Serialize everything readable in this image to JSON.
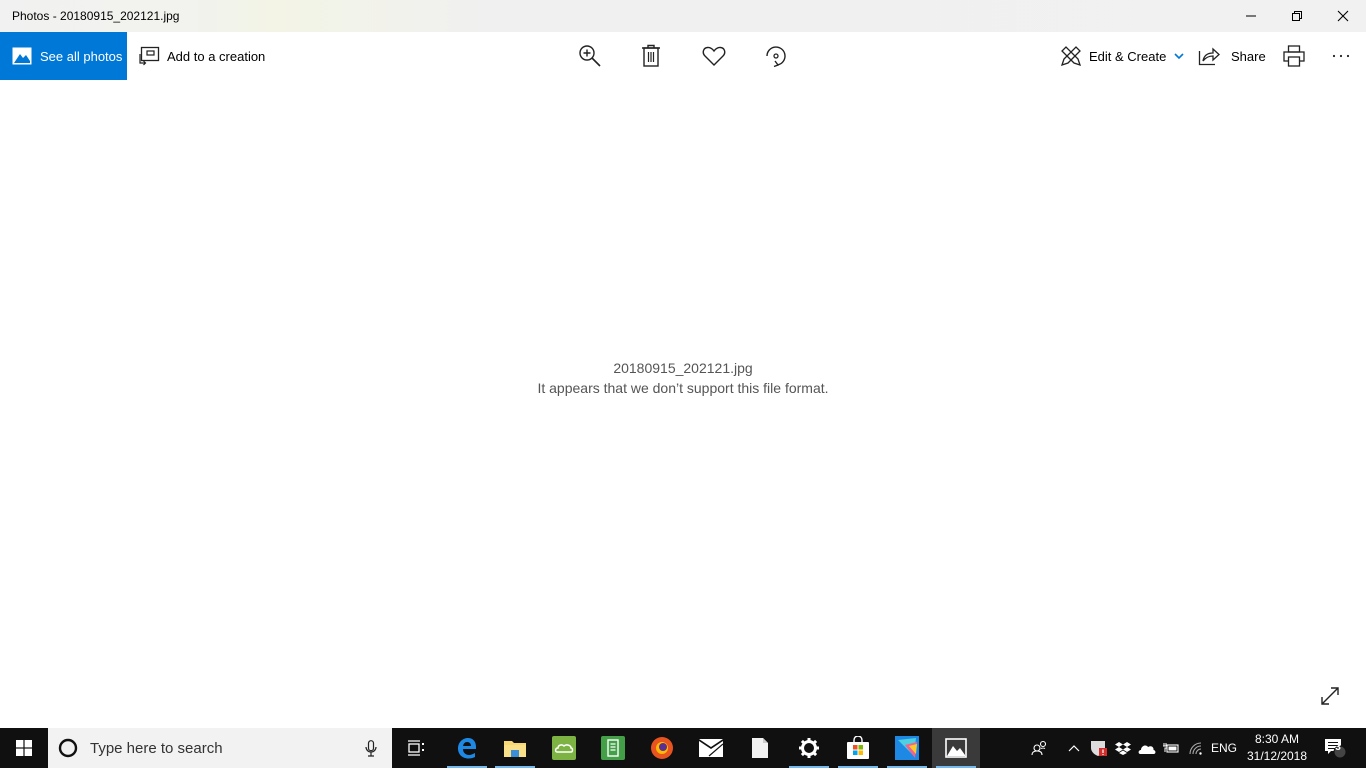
{
  "window": {
    "title": "Photos - 20180915_202121.jpg",
    "controls": {
      "minimize": "minimize-icon",
      "restore": "restore-icon",
      "close": "close-icon"
    }
  },
  "toolbar": {
    "see_all_photos": "See all photos",
    "add_to_creation": "Add to a creation",
    "zoom_icon": "zoom-in-icon",
    "delete_icon": "delete-icon",
    "favorite_icon": "heart-icon",
    "rotate_icon": "rotate-icon",
    "edit_create": "Edit & Create",
    "share": "Share",
    "print_icon": "print-icon",
    "more_icon": "more-icon",
    "accent_color": "#0078d7"
  },
  "main": {
    "filename": "20180915_202121.jpg",
    "error_message": "It appears that we don’t support this file format.",
    "fullscreen_icon": "expand-icon"
  },
  "taskbar": {
    "search_placeholder": "Type here to search",
    "apps": [
      {
        "name": "Microsoft Edge",
        "running": true
      },
      {
        "name": "File Explorer",
        "running": true
      },
      {
        "name": "Cloud app",
        "running": false
      },
      {
        "name": "Notes app",
        "running": false
      },
      {
        "name": "Firefox",
        "running": false
      },
      {
        "name": "Mail",
        "running": false
      },
      {
        "name": "Document",
        "running": false
      },
      {
        "name": "Settings",
        "running": true
      },
      {
        "name": "Microsoft Store",
        "running": true
      },
      {
        "name": "Paint app",
        "running": true
      },
      {
        "name": "Photos",
        "running": true,
        "active": true
      }
    ],
    "tray": {
      "language": "ENG",
      "time": "8:30 AM",
      "date": "31/12/2018",
      "notification_count": "3"
    }
  }
}
